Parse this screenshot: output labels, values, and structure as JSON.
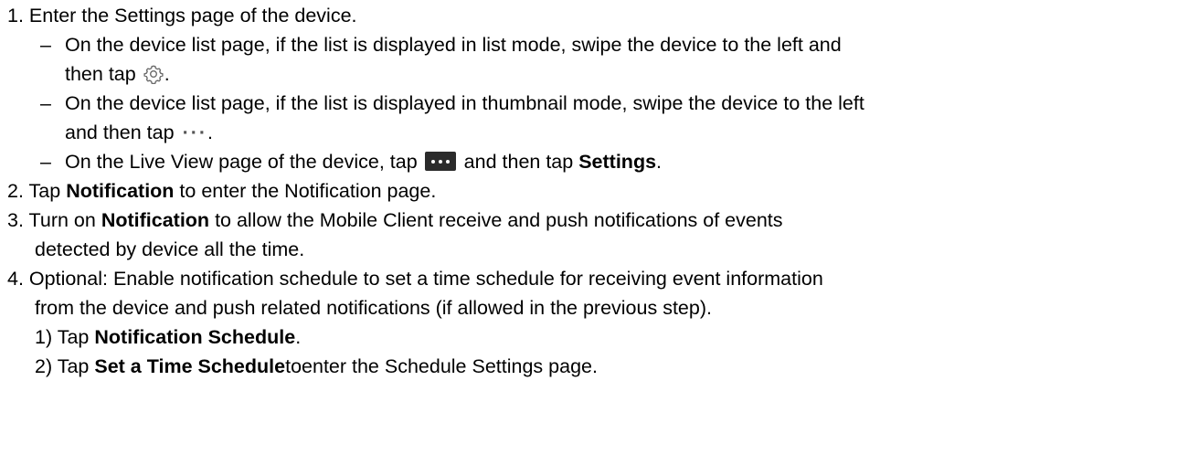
{
  "steps": {
    "s1": {
      "num": "1.",
      "text": "Enter the Settings page of the device.",
      "bullets": {
        "b1": {
          "dash": "–",
          "line1": "On the device list page, if the list is displayed in list mode, swipe the device to the left and",
          "line2_pre": "then tap",
          "line2_post": ".",
          "icon": "gear-icon"
        },
        "b2": {
          "dash": "–",
          "line1": "On the device list page, if the list is displayed in thumbnail mode, swipe the device to the left",
          "line2_pre": "and then tap",
          "dots": "···",
          "line2_post": ".",
          "icon": "more-dots-icon"
        },
        "b3": {
          "dash": "–",
          "pre": "On the Live View page of the device, tap",
          "mid": "and then tap",
          "bold": "Settings",
          "post": ".",
          "icon": "more-button-icon"
        }
      }
    },
    "s2": {
      "num": "2.",
      "pre": "Tap",
      "bold": "Notification",
      "post": "to enter the Notification page."
    },
    "s3": {
      "num": "3.",
      "pre": "Turn on",
      "bold": "Notification",
      "post": "to allow the Mobile Client receive and push notifications of events",
      "line2": "detected by device all the time."
    },
    "s4": {
      "num": "4.",
      "line1": "Optional: Enable notification schedule to set a time schedule for receiving event information",
      "line2": "from the device and push related notifications (if allowed in the previous step).",
      "sub1": {
        "num": "1)",
        "pre": "Tap",
        "bold": "Notification Schedule",
        "post": "."
      },
      "sub2": {
        "num": "2)",
        "pre": "Tap",
        "bold": "Set a Time Schedule",
        "post": "toenter the Schedule Settings page."
      }
    }
  },
  "colors": {
    "text": "#000000",
    "icon_dark": "#2b2b2b"
  }
}
